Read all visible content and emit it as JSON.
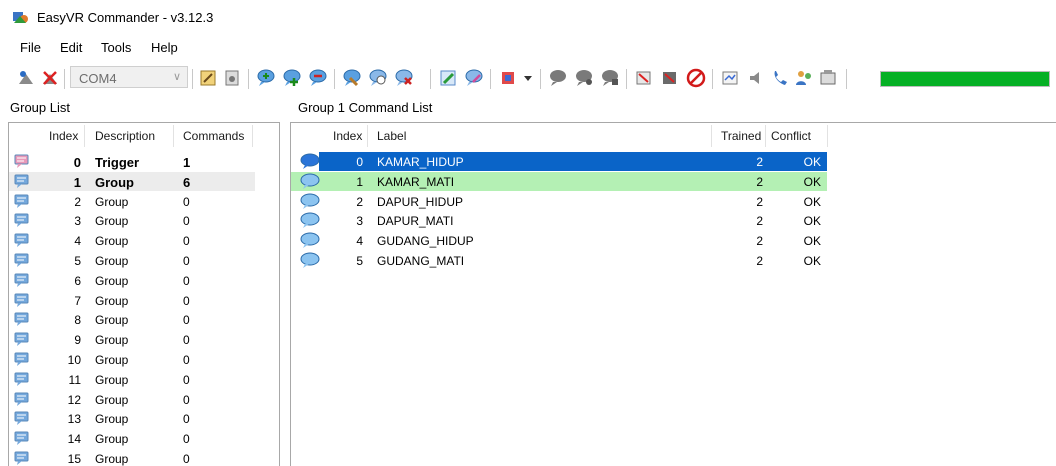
{
  "window": {
    "title": "EasyVR Commander - v3.12.3"
  },
  "menu": {
    "items": [
      "File",
      "Edit",
      "Tools",
      "Help"
    ]
  },
  "toolbar": {
    "port": "COM4",
    "progress": 1.0,
    "progress_color": "#06b025"
  },
  "group_list": {
    "title": "Group List",
    "headers": {
      "index": "Index",
      "description": "Description",
      "commands": "Commands"
    },
    "rows": [
      {
        "index": "0",
        "description": "Trigger",
        "commands": "1"
      },
      {
        "index": "1",
        "description": "Group",
        "commands": "6"
      },
      {
        "index": "2",
        "description": "Group",
        "commands": "0"
      },
      {
        "index": "3",
        "description": "Group",
        "commands": "0"
      },
      {
        "index": "4",
        "description": "Group",
        "commands": "0"
      },
      {
        "index": "5",
        "description": "Group",
        "commands": "0"
      },
      {
        "index": "6",
        "description": "Group",
        "commands": "0"
      },
      {
        "index": "7",
        "description": "Group",
        "commands": "0"
      },
      {
        "index": "8",
        "description": "Group",
        "commands": "0"
      },
      {
        "index": "9",
        "description": "Group",
        "commands": "0"
      },
      {
        "index": "10",
        "description": "Group",
        "commands": "0"
      },
      {
        "index": "11",
        "description": "Group",
        "commands": "0"
      },
      {
        "index": "12",
        "description": "Group",
        "commands": "0"
      },
      {
        "index": "13",
        "description": "Group",
        "commands": "0"
      },
      {
        "index": "14",
        "description": "Group",
        "commands": "0"
      },
      {
        "index": "15",
        "description": "Group",
        "commands": "0"
      }
    ]
  },
  "command_list": {
    "title": "Group 1 Command List",
    "headers": {
      "index": "Index",
      "label": "Label",
      "trained": "Trained",
      "conflict": "Conflict"
    },
    "rows": [
      {
        "index": "0",
        "label": "KAMAR_HIDUP",
        "trained": "2",
        "conflict": "OK"
      },
      {
        "index": "1",
        "label": "KAMAR_MATI",
        "trained": "2",
        "conflict": "OK"
      },
      {
        "index": "2",
        "label": "DAPUR_HIDUP",
        "trained": "2",
        "conflict": "OK"
      },
      {
        "index": "3",
        "label": "DAPUR_MATI",
        "trained": "2",
        "conflict": "OK"
      },
      {
        "index": "4",
        "label": "GUDANG_HIDUP",
        "trained": "2",
        "conflict": "OK"
      },
      {
        "index": "5",
        "label": "GUDANG_MATI",
        "trained": "2",
        "conflict": "OK"
      }
    ]
  }
}
